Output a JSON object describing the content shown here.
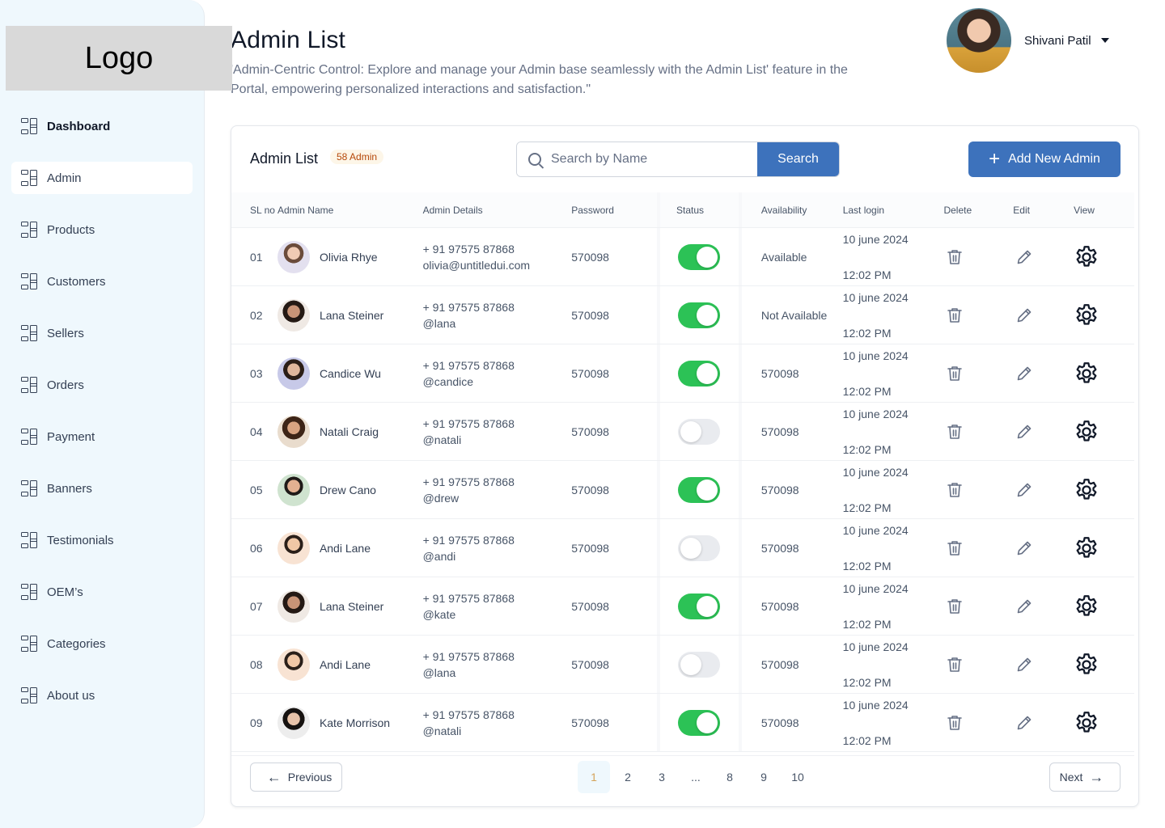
{
  "logo": "Logo",
  "sidebar": {
    "items": [
      {
        "label": "Dashboard"
      },
      {
        "label": "Admin"
      },
      {
        "label": "Products"
      },
      {
        "label": "Customers"
      },
      {
        "label": "Sellers"
      },
      {
        "label": "Orders"
      },
      {
        "label": "Payment"
      },
      {
        "label": "Banners"
      },
      {
        "label": "Testimonials"
      },
      {
        "label": "OEM’s"
      },
      {
        "label": "Categories"
      },
      {
        "label": "About us"
      }
    ]
  },
  "header": {
    "title": "Admin List",
    "description": "'Admin-Centric Control: Explore and manage your Admin base seamlessly with the Admin List' feature in the Portal, empowering personalized interactions and satisfaction.\""
  },
  "user": {
    "name": "Shivani Patil"
  },
  "card": {
    "title": "Admin List",
    "badge": "58 Admin",
    "search_placeholder": "Search by Name",
    "search_button": "Search",
    "add_button": "Add New Admin"
  },
  "table": {
    "headers": {
      "sl": "SL no",
      "name": "Admin Name",
      "details": "Admin Details",
      "password": "Password",
      "status": "Status",
      "availability": "Availability",
      "last_login": "Last login",
      "delete": "Delete",
      "edit": "Edit",
      "view": "View"
    },
    "rows": [
      {
        "sl": "01",
        "name": "Olivia Rhye",
        "phone": "+ 91 97575 87868",
        "handle": "olivia@untitledui.com",
        "password": "570098",
        "status": true,
        "availability": "Available",
        "date": "10 june 2024",
        "time": "12:02 PM"
      },
      {
        "sl": "02",
        "name": "Lana Steiner",
        "phone": "+ 91 97575 87868",
        "handle": "@lana",
        "password": "570098",
        "status": true,
        "availability": "Not Available",
        "date": "10 june 2024",
        "time": "12:02 PM"
      },
      {
        "sl": "03",
        "name": "Candice Wu",
        "phone": "+ 91 97575 87868",
        "handle": "@candice",
        "password": "570098",
        "status": true,
        "availability": "570098",
        "date": "10 june 2024",
        "time": "12:02 PM"
      },
      {
        "sl": "04",
        "name": "Natali Craig",
        "phone": "+ 91 97575 87868",
        "handle": "@natali",
        "password": "570098",
        "status": false,
        "availability": "570098",
        "date": "10 june 2024",
        "time": "12:02 PM"
      },
      {
        "sl": "05",
        "name": "Drew Cano",
        "phone": "+ 91 97575 87868",
        "handle": "@drew",
        "password": "570098",
        "status": true,
        "availability": "570098",
        "date": "10 june 2024",
        "time": "12:02 PM"
      },
      {
        "sl": "06",
        "name": "Andi Lane",
        "phone": "+ 91 97575 87868",
        "handle": "@andi",
        "password": "570098",
        "status": false,
        "availability": "570098",
        "date": "10 june 2024",
        "time": "12:02 PM"
      },
      {
        "sl": "07",
        "name": "Lana Steiner",
        "phone": "+ 91 97575 87868",
        "handle": "@kate",
        "password": "570098",
        "status": true,
        "availability": "570098",
        "date": "10 june 2024",
        "time": "12:02 PM"
      },
      {
        "sl": "08",
        "name": "Andi Lane",
        "phone": "+ 91 97575 87868",
        "handle": "@lana",
        "password": "570098",
        "status": false,
        "availability": "570098",
        "date": "10 june 2024",
        "time": "12:02 PM"
      },
      {
        "sl": "09",
        "name": "Kate Morrison",
        "phone": "+ 91 97575 87868",
        "handle": "@natali",
        "password": "570098",
        "status": true,
        "availability": "570098",
        "date": "10 june 2024",
        "time": "12:02 PM"
      }
    ]
  },
  "pagination": {
    "previous": "Previous",
    "next": "Next",
    "pages": [
      "1",
      "2",
      "3",
      "...",
      "8",
      "9",
      "10"
    ],
    "current": "1"
  },
  "colors": {
    "accent": "#3d72bc",
    "toggle_on": "#2cc256",
    "sidebar_bg": "#eff8fd"
  },
  "icons": {
    "nav": "grid-icon",
    "search": "search-icon",
    "add": "plus-icon",
    "delete": "trash-icon",
    "edit": "pencil-icon",
    "view": "gear-icon",
    "prev": "arrow-left-icon",
    "next": "arrow-right-icon"
  }
}
